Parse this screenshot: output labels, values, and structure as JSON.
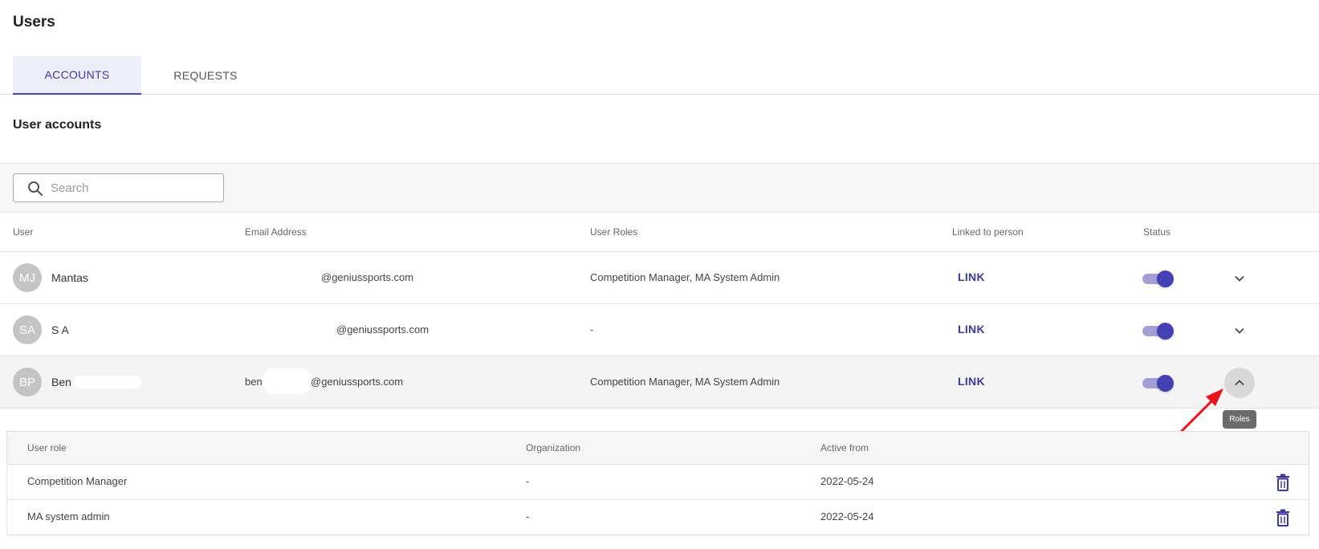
{
  "page": {
    "title": "Users"
  },
  "tabs": [
    {
      "label": "ACCOUNTS",
      "active": true
    },
    {
      "label": "REQUESTS",
      "active": false
    }
  ],
  "section": {
    "title": "User accounts"
  },
  "search": {
    "placeholder": "Search",
    "value": ""
  },
  "table": {
    "headers": {
      "user": "User",
      "email": "Email Address",
      "roles": "User Roles",
      "linked": "Linked to person",
      "status": "Status"
    },
    "rows": [
      {
        "initials": "MJ",
        "name": "Mantas",
        "email": "@geniussports.com",
        "roles": "Competition Manager, MA System Admin",
        "link": "LINK",
        "status_on": true,
        "expanded": false
      },
      {
        "initials": "SA",
        "name": "S A",
        "email": "@geniussports.com",
        "roles": "-",
        "link": "LINK",
        "status_on": true,
        "expanded": false
      },
      {
        "initials": "BP",
        "name": "Ben",
        "email_prefix": "ben",
        "email": "@geniussports.com",
        "roles": "Competition Manager, MA System Admin",
        "link": "LINK",
        "status_on": true,
        "expanded": true
      }
    ]
  },
  "tooltip": {
    "text": "Roles"
  },
  "role_details": {
    "headers": {
      "role": "User role",
      "organization": "Organization",
      "active_from": "Active from"
    },
    "rows": [
      {
        "role": "Competition Manager",
        "organization": "-",
        "active_from": "2022-05-24"
      },
      {
        "role": "MA system admin",
        "organization": "-",
        "active_from": "2022-05-24"
      }
    ]
  },
  "colors": {
    "accent": "#4540b3",
    "toggle_track": "#a39fd6",
    "annotation_arrow": "#e8141c",
    "tab_active_bg": "#eeeef8"
  },
  "icons": {
    "search": "search-icon",
    "expand": "chevron-down-icon",
    "collapse": "chevron-up-icon",
    "delete": "trash-icon"
  }
}
